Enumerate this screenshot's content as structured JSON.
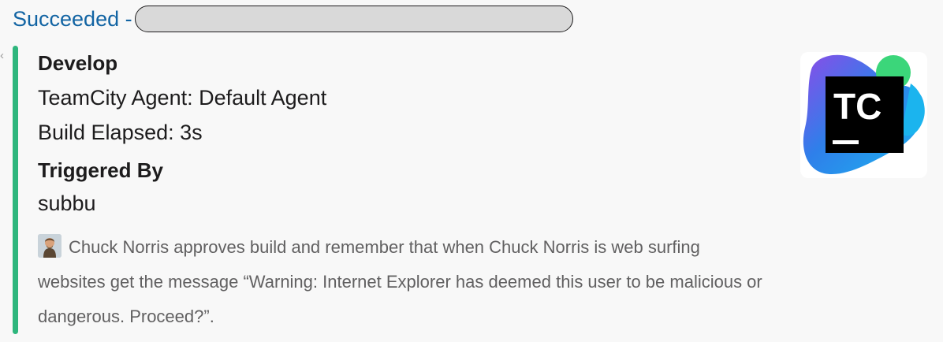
{
  "header": {
    "status_text": "Succeeded -"
  },
  "attachment": {
    "accent_color": "#2eb67d",
    "branch_title": "Develop",
    "agent_line": "TeamCity Agent: Default Agent",
    "elapsed_line": "Build Elapsed: 3s",
    "triggered_by_title": "Triggered By",
    "triggered_by_value": "subbu",
    "footer_text": "Chuck Norris approves build and remember that when Chuck Norris is web surfing websites get the message “Warning: Internet Explorer has deemed this user to be malicious or dangerous. Proceed?”.",
    "footer_icon": "chuck-norris-avatar-icon",
    "thumb_icon": "teamcity-logo-icon",
    "thumb_text": "TC"
  }
}
